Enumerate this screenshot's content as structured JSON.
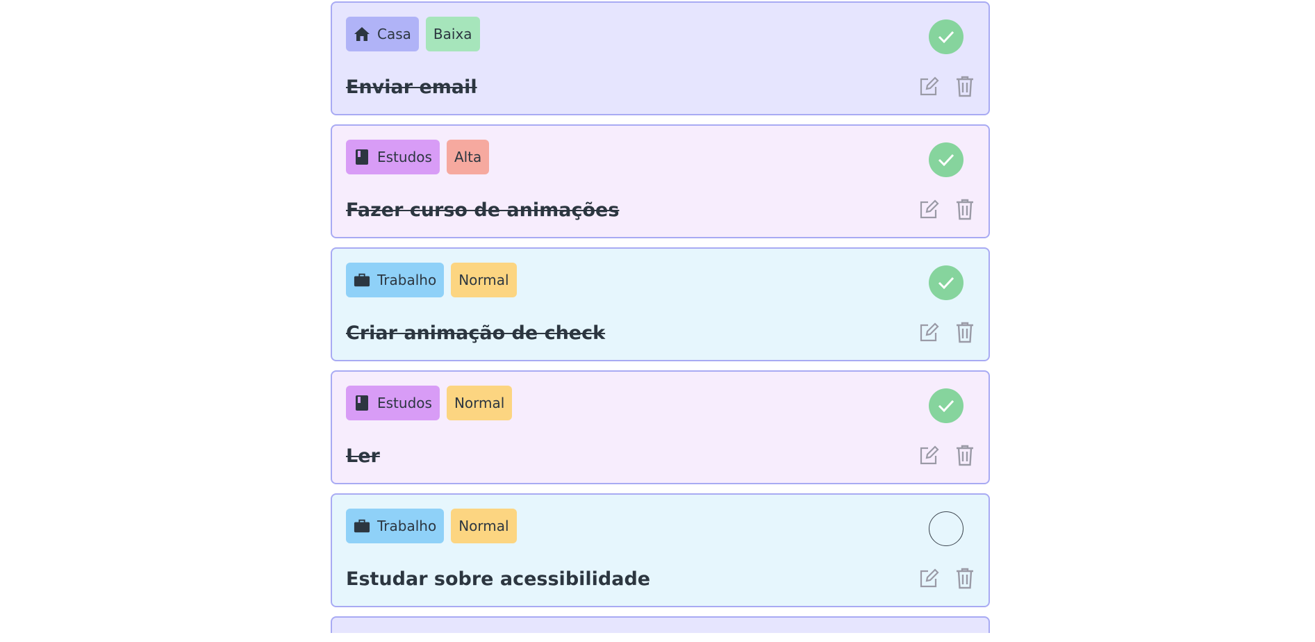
{
  "tasks": [
    {
      "category": "Casa",
      "category_icon": "home-icon",
      "priority": "Baixa",
      "title": "Enviar email",
      "completed": true
    },
    {
      "category": "Estudos",
      "category_icon": "book-icon",
      "priority": "Alta",
      "title": "Fazer curso de animações",
      "completed": true
    },
    {
      "category": "Trabalho",
      "category_icon": "briefcase-icon",
      "priority": "Normal",
      "title": "Criar animação de check",
      "completed": true
    },
    {
      "category": "Estudos",
      "category_icon": "book-icon",
      "priority": "Normal",
      "title": "Ler",
      "completed": true
    },
    {
      "category": "Trabalho",
      "category_icon": "briefcase-icon",
      "priority": "Normal",
      "title": "Estudar sobre acessibilidade",
      "completed": false
    }
  ],
  "colors": {
    "casa_card": "#e6e5fe",
    "estudos_card": "#f7edfd",
    "trabalho_card": "#e6f6fd",
    "check_done": "#86d49d",
    "card_border": "#a8aaf3"
  }
}
